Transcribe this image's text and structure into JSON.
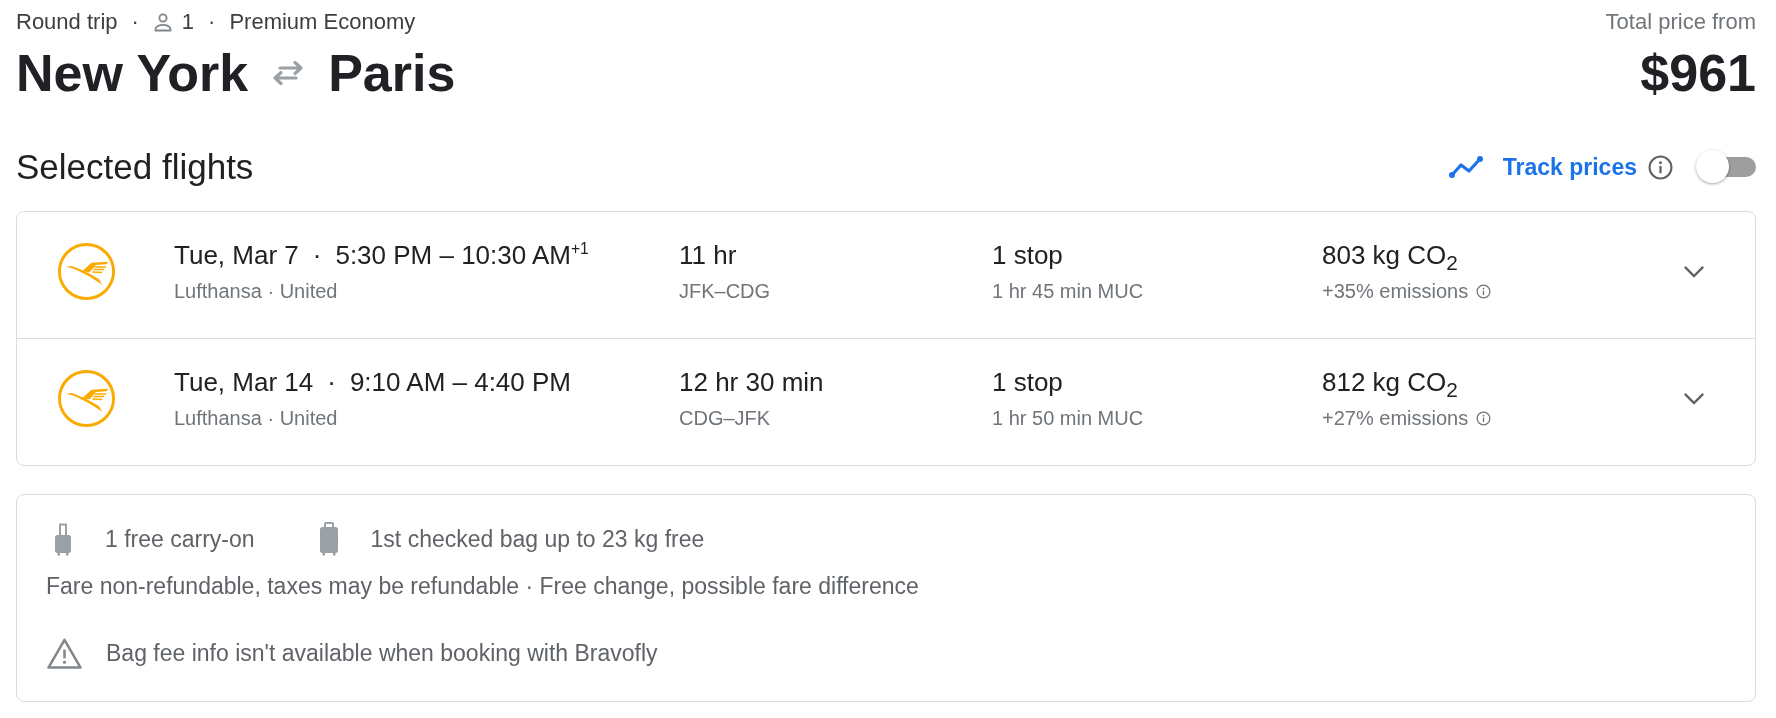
{
  "trip_summary": [
    {
      "kind": "text",
      "label": "Round trip"
    },
    {
      "kind": "separator",
      "label": "·"
    },
    {
      "kind": "passengers",
      "label": "1"
    },
    {
      "kind": "separator",
      "label": "·"
    },
    {
      "kind": "text",
      "label": "Premium Economy"
    }
  ],
  "route": {
    "origin": "New York",
    "destination": "Paris"
  },
  "price": {
    "label": "Total price from",
    "amount": "$961"
  },
  "selected_flights": {
    "title": "Selected flights",
    "track_prices": {
      "label": "Track prices",
      "on": false
    },
    "flights": [
      {
        "date": "Tue, Mar 7",
        "separator": "·",
        "times": "5:30 PM – 10:30 AM$^{+1}$",
        "airlines": "Lufthansa · United",
        "duration": "11 hr",
        "airports": "JFK–CDG",
        "stops": "1 stop",
        "layover": "1 hr 45 min MUC",
        "emissions": "803 kg CO$_{2}$",
        "emissions_change": "+35% emissions",
        "expanded": false
      },
      {
        "date": "Tue, Mar 14",
        "separator": "·",
        "times": "9:10 AM – 4:40 PM",
        "airlines": "Lufthansa · United",
        "duration": "12 hr 30 min",
        "airports": "CDG–JFK",
        "stops": "1 stop",
        "layover": "1 hr 50 min MUC",
        "emissions": "812 kg CO$_{2}$",
        "emissions_change": "+27% emissions",
        "expanded": false
      }
    ]
  },
  "fare_details": {
    "baggage": [
      {
        "kind": "carry_on",
        "label": "1 free carry-on"
      },
      {
        "kind": "checked",
        "label": "1st checked bag up to 23 kg free"
      }
    ],
    "policy": "Fare non-refundable, taxes may be refundable · Free change, possible fare difference",
    "warning": "Bag fee info isn't available when booking with Bravofly"
  }
}
